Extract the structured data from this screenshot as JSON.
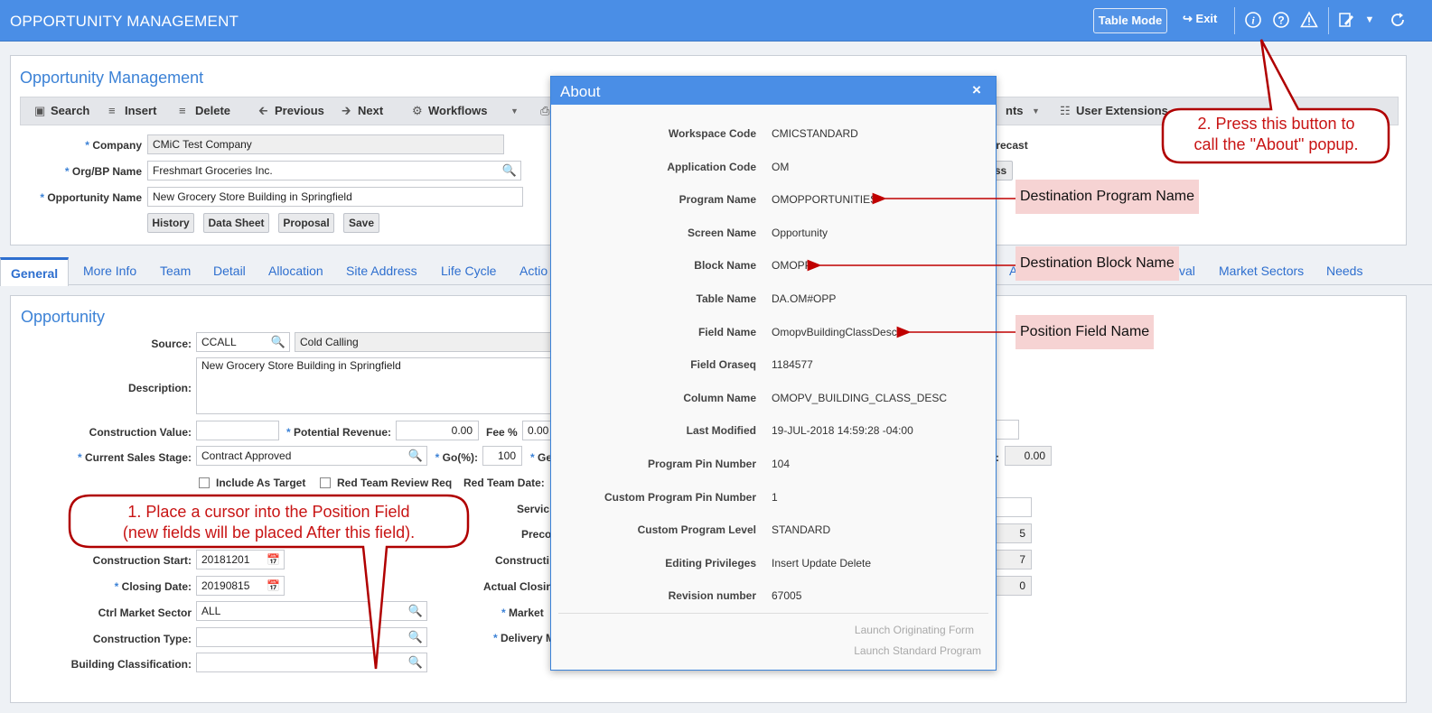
{
  "header": {
    "title": "OPPORTUNITY MANAGEMENT",
    "table_mode": "Table Mode",
    "exit": "Exit"
  },
  "form": {
    "title": "Opportunity Management",
    "toolbar": {
      "search": "Search",
      "insert": "Insert",
      "delete": "Delete",
      "previous": "Previous",
      "next": "Next",
      "workflows": "Workflows",
      "attachments_partial": "nts",
      "user_extensions": "User Extensions"
    },
    "company_label": "Company",
    "company_value": "CMiC Test Company",
    "org_label": "Org/BP Name",
    "org_value": "Freshmart Groceries Inc.",
    "opp_label": "Opportunity Name",
    "opp_value": "New Grocery Store Building in Springfield",
    "buttons": {
      "history": "History",
      "data_sheet": "Data Sheet",
      "proposal": "Proposal",
      "save": "Save"
    },
    "forecast_partial": "precast",
    "ss_partial": "ss"
  },
  "tabs": {
    "general": "General",
    "more_info": "More Info",
    "team": "Team",
    "detail": "Detail",
    "allocation": "Allocation",
    "site_address": "Site Address",
    "life_cycle": "Life Cycle",
    "action_partial": "Actio",
    "a_partial": "A",
    "val_partial": "val",
    "market_sectors": "Market Sectors",
    "needs": "Needs"
  },
  "opportunity": {
    "title": "Opportunity",
    "source_label": "Source:",
    "source_code": "CCALL",
    "source_desc": "Cold Calling",
    "description_label": "Description:",
    "description_value": "New Grocery Store Building in Springfield",
    "construction_value_label": "Construction Value:",
    "potential_revenue_label": "Potential Revenue:",
    "potential_revenue_value": "0.00",
    "fee_label": "Fee %",
    "fee_value": "0.00",
    "sales_stage_label": "Current Sales Stage:",
    "sales_stage_value": "Contract Approved",
    "go_label": "Go(%):",
    "go_value": "100",
    "ge_partial": "Ge",
    "include_target": "Include As Target",
    "red_team_review": "Red Team Review Req",
    "red_team_date": "Red Team Date:",
    "service_partial": "Servic",
    "preco_partial": "Preco",
    "construction_partial": "Constructi",
    "actual_closing_partial": "Actual Closin",
    "market_partial": "Market",
    "delivery_partial": "Delivery M",
    "construction_start_label": "Construction Start:",
    "construction_start_value": "20181201",
    "closing_date_label": "Closing Date:",
    "closing_date_value": "20190815",
    "ctrl_market_label": "Ctrl Market Sector",
    "ctrl_market_value": "ALL",
    "construction_type_label": "Construction Type:",
    "building_class_label": "Building Classification:",
    "right_value_1": "0.00",
    "right_value_2": "5",
    "right_value_3": "7",
    "right_value_4": "0",
    "colon_partial": ":"
  },
  "about": {
    "title": "About",
    "close": "×",
    "rows": [
      {
        "label": "Workspace Code",
        "value": "CMICSTANDARD"
      },
      {
        "label": "Application Code",
        "value": "OM"
      },
      {
        "label": "Program Name",
        "value": "OMOPPORTUNITIES"
      },
      {
        "label": "Screen Name",
        "value": "Opportunity"
      },
      {
        "label": "Block Name",
        "value": "OMOPP"
      },
      {
        "label": "Table Name",
        "value": "DA.OM#OPP"
      },
      {
        "label": "Field Name",
        "value": "OmopvBuildingClassDesc"
      },
      {
        "label": "Field Oraseq",
        "value": "1184577"
      },
      {
        "label": "Column Name",
        "value": "OMOPV_BUILDING_CLASS_DESC"
      },
      {
        "label": "Last Modified",
        "value": "19-JUL-2018 14:59:28 -04:00"
      },
      {
        "label": "Program Pin Number",
        "value": "104"
      },
      {
        "label": "Custom Program Pin Number",
        "value": "1"
      },
      {
        "label": "Custom Program Level",
        "value": "STANDARD"
      },
      {
        "label": "Editing Privileges",
        "value": "Insert Update Delete"
      },
      {
        "label": "Revision number",
        "value": "67005"
      }
    ],
    "launch_originating": "Launch Originating Form",
    "launch_standard": "Launch Standard Program"
  },
  "annotations": {
    "dest_program": "Destination Program Name",
    "dest_block": "Destination Block Name",
    "position_field": "Position Field Name",
    "callout1_line1": "1. Place a cursor into the Position Field",
    "callout1_line2": "(new fields will be placed After this field).",
    "callout2_line1": "2. Press this button to",
    "callout2_line2": "call the \"About\" popup."
  },
  "colors": {
    "header_blue": "#4a8ee6",
    "link_blue": "#2e6fcf",
    "annotation_red": "#c00000",
    "tag_pink": "#f6d3d3"
  }
}
